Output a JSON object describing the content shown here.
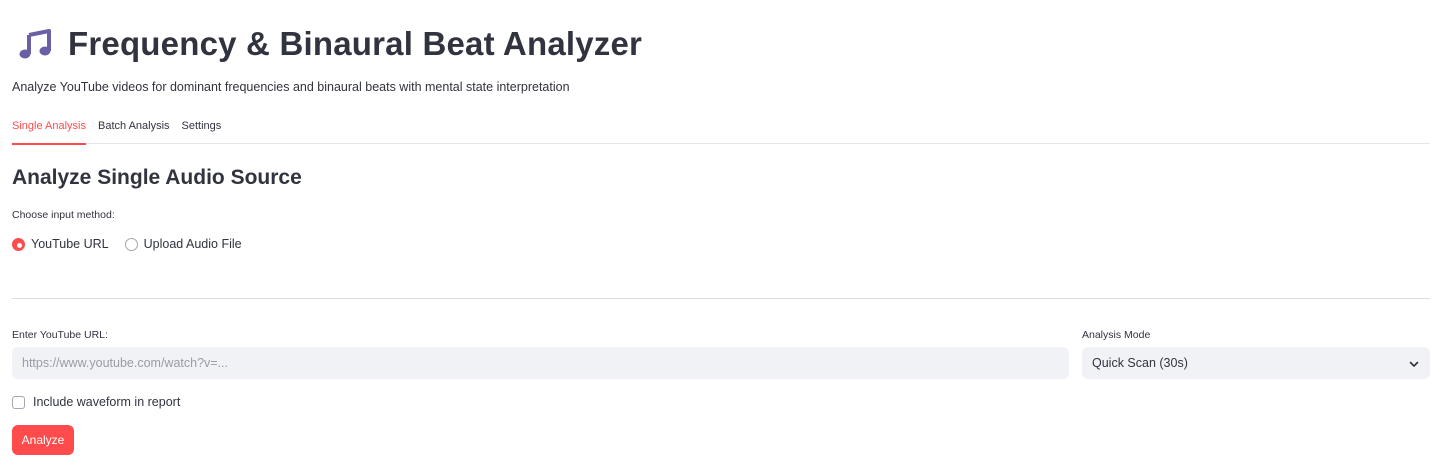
{
  "header": {
    "icon": "musical-notes-icon",
    "title": "Frequency & Binaural Beat Analyzer",
    "subtitle": "Analyze YouTube videos for dominant frequencies and binaural beats with mental state interpretation"
  },
  "tabs": [
    {
      "label": "Single Analysis",
      "active": true
    },
    {
      "label": "Batch Analysis",
      "active": false
    },
    {
      "label": "Settings",
      "active": false
    }
  ],
  "single": {
    "heading": "Analyze Single Audio Source",
    "input_method_label": "Choose input method:",
    "input_methods": [
      {
        "label": "YouTube URL",
        "selected": true
      },
      {
        "label": "Upload Audio File",
        "selected": false
      }
    ],
    "url_label": "Enter YouTube URL:",
    "url_value": "",
    "url_placeholder": "https://www.youtube.com/watch?v=...",
    "mode_label": "Analysis Mode",
    "mode_value": "Quick Scan (30s)",
    "waveform_checkbox_label": "Include waveform in report",
    "waveform_checked": false,
    "analyze_label": "Analyze"
  },
  "colors": {
    "accent": "#ff4b4b",
    "text": "#31333f",
    "input_bg": "#f0f2f6",
    "icon_purple": "#6b5fa6"
  }
}
